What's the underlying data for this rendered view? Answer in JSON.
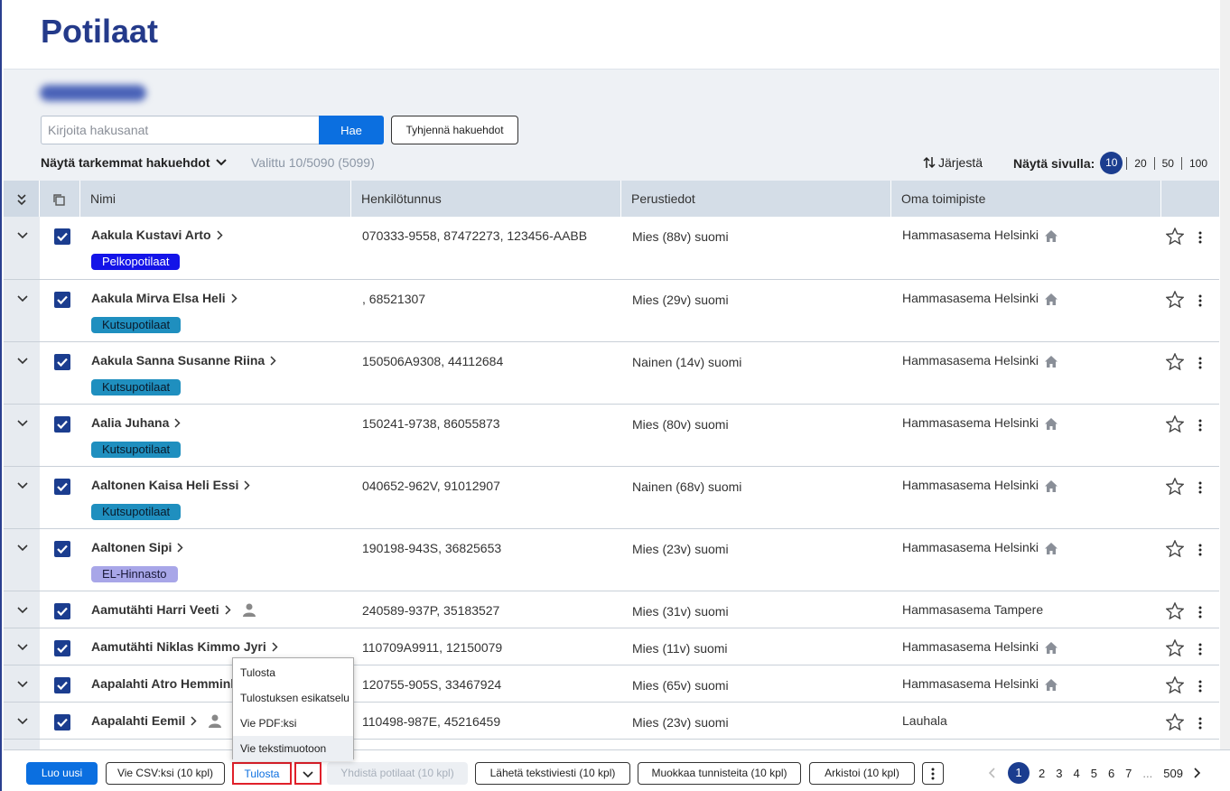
{
  "page": {
    "title": "Potilaat"
  },
  "search": {
    "placeholder": "Kirjoita hakusanat",
    "value": "",
    "search_label": "Hae",
    "clear_label": "Tyhjennä hakuehdot",
    "advanced_label": "Näytä tarkemmat hakuehdot",
    "selected_text": "Valittu 10/5090 (5099)",
    "sort_label": "Järjestä",
    "page_size_label": "Näytä sivulla:",
    "page_size_options": [
      "10",
      "20",
      "50",
      "100"
    ],
    "page_size_selected": "10"
  },
  "table": {
    "columns": [
      "Nimi",
      "Henkilötunnus",
      "Perustiedot",
      "Oma toimipiste"
    ],
    "rows": [
      {
        "name": "Aakula Kustavi Arto",
        "tag": "Pelkopotilaat",
        "tag_bg": "#1414e8",
        "tag_fg": "#ffffff",
        "ssn": "070333-9558, 87472273, 123456-AABB",
        "basic": "Mies (88v) suomi",
        "office": "Hammasasema Helsinki",
        "home": true,
        "person": false
      },
      {
        "name": "Aakula Mirva Elsa Heli",
        "tag": "Kutsupotilaat",
        "tag_bg": "#1f8fbf",
        "tag_fg": "#0a1a2a",
        "ssn": ", 68521307",
        "basic": "Mies (29v) suomi",
        "office": "Hammasasema Helsinki",
        "home": true,
        "person": false
      },
      {
        "name": "Aakula Sanna Susanne Riina",
        "tag": "Kutsupotilaat",
        "tag_bg": "#1f8fbf",
        "tag_fg": "#0a1a2a",
        "ssn": "150506A9308, 44112684",
        "basic": "Nainen (14v) suomi",
        "office": "Hammasasema Helsinki",
        "home": true,
        "person": false
      },
      {
        "name": "Aalia Juhana",
        "tag": "Kutsupotilaat",
        "tag_bg": "#1f8fbf",
        "tag_fg": "#0a1a2a",
        "ssn": "150241-9738, 86055873",
        "basic": "Mies (80v) suomi",
        "office": "Hammasasema Helsinki",
        "home": true,
        "person": false
      },
      {
        "name": "Aaltonen Kaisa Heli Essi",
        "tag": "Kutsupotilaat",
        "tag_bg": "#1f8fbf",
        "tag_fg": "#0a1a2a",
        "ssn": "040652-962V, 91012907",
        "basic": "Nainen (68v) suomi",
        "office": "Hammasasema Helsinki",
        "home": true,
        "person": false
      },
      {
        "name": "Aaltonen Sipi",
        "tag": "EL-Hinnasto",
        "tag_bg": "#a8a6e8",
        "tag_fg": "#1a1a3a",
        "ssn": "190198-943S, 36825653",
        "basic": "Mies (23v) suomi",
        "office": "Hammasasema Helsinki",
        "home": true,
        "person": false
      },
      {
        "name": "Aamutähti Harri Veeti",
        "tag": "",
        "ssn": "240589-937P, 35183527",
        "basic": "Mies (31v) suomi",
        "office": "Hammasasema Tampere",
        "home": false,
        "person": true
      },
      {
        "name": "Aamutähti Niklas Kimmo Jyri",
        "tag": "",
        "ssn": "110709A9911, 12150079",
        "basic": "Mies (11v) suomi",
        "office": "Hammasasema Helsinki",
        "home": true,
        "person": false
      },
      {
        "name": "Aapalahti Atro Hemmink",
        "tag": "",
        "ssn": "120755-905S, 33467924",
        "basic": "Mies (65v) suomi",
        "office": "Hammasasema Helsinki",
        "home": true,
        "person": false
      },
      {
        "name": "Aapalahti Eemil",
        "tag": "",
        "ssn": "110498-987E, 45216459",
        "basic": "Mies (23v) suomi",
        "office": "Lauhala",
        "home": false,
        "person": true
      }
    ]
  },
  "footer": {
    "new_label": "Luo uusi",
    "csv_label": "Vie CSV:ksi (10 kpl)",
    "print_label": "Tulosta",
    "merge_label": "Yhdistä potilaat (10 kpl)",
    "sms_label": "Lähetä tekstiviesti (10 kpl)",
    "edit_tags_label": "Muokkaa tunnisteita (10 kpl)",
    "archive_label": "Arkistoi (10 kpl)",
    "pages": [
      "1",
      "2",
      "3",
      "4",
      "5",
      "6",
      "7"
    ],
    "current_page": "1",
    "ellipsis": "...",
    "last_page": "509"
  },
  "print_menu": {
    "items": [
      "Tulosta",
      "Tulostuksen esikatselu",
      "Vie PDF:ksi",
      "Vie tekstimuotoon"
    ],
    "hovered_index": 3
  },
  "colors": {
    "accent": "#0b6fe0",
    "primary_dark": "#1b3d8f",
    "title": "#243a8a",
    "highlight": "#e0202a"
  }
}
